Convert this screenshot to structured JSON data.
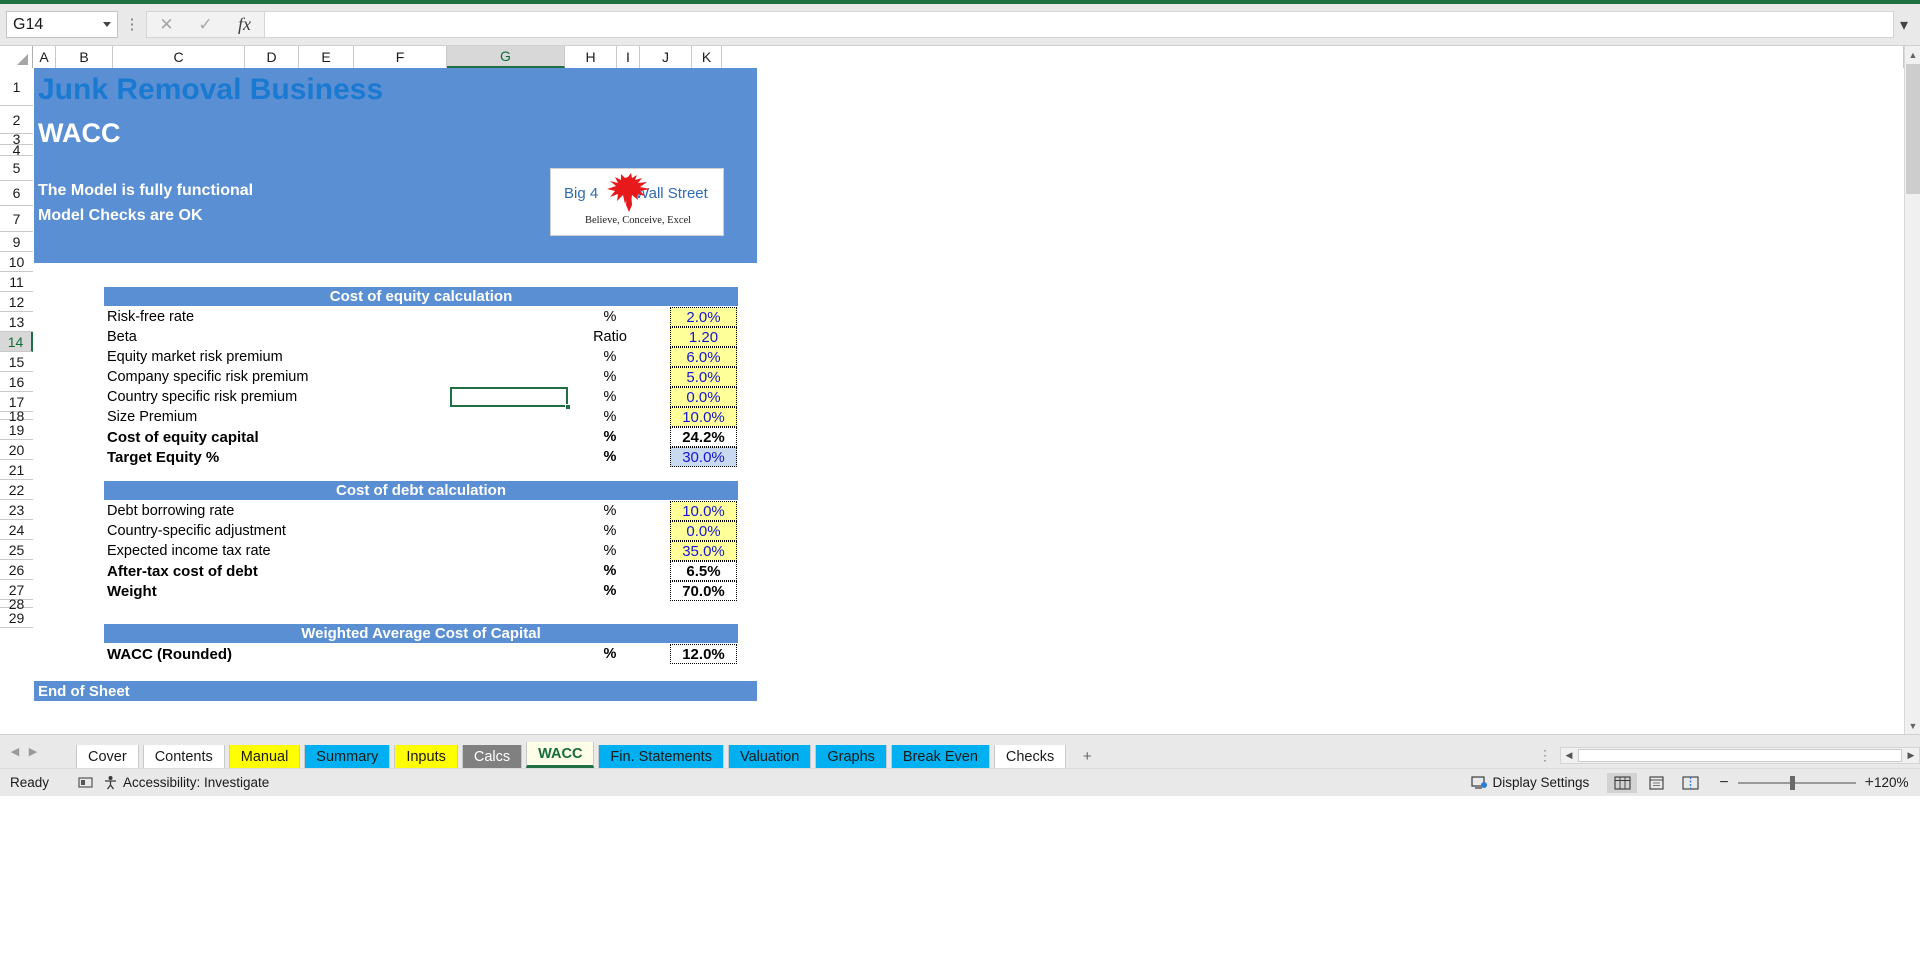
{
  "formula_bar": {
    "name_box_value": "G14",
    "formula_value": "",
    "cancel_icon": "cancel-icon",
    "confirm_icon": "confirm-icon",
    "function_icon": "fx-icon"
  },
  "grid": {
    "columns": [
      "A",
      "B",
      "C",
      "D",
      "E",
      "F",
      "G",
      "H",
      "I",
      "J",
      "K"
    ],
    "active_column": "G",
    "rows": [
      "1",
      "2",
      "3",
      "4",
      "5",
      "6",
      "7",
      "9",
      "10",
      "11",
      "12",
      "13",
      "14",
      "15",
      "16",
      "17",
      "18",
      "19",
      "20",
      "21",
      "22",
      "23",
      "24",
      "25",
      "26",
      "27",
      "28",
      "29"
    ],
    "active_row": "14"
  },
  "banner": {
    "title": "Junk Removal Business",
    "subtitle": "WACC",
    "note_1": "The Model is fully functional",
    "note_2": "Model Checks are OK"
  },
  "logo": {
    "text_left": "Big 4",
    "text_right": "Wall Street",
    "tagline": "Believe, Conceive, Excel",
    "eagle_icon": "eagle-icon"
  },
  "sections": [
    {
      "header": "Cost of equity calculation",
      "rows": [
        {
          "label": "Risk-free rate",
          "unit": "%",
          "value": "2.0%",
          "style": "input",
          "bold": false
        },
        {
          "label": "Beta",
          "unit": "Ratio",
          "value": "1.20",
          "style": "input",
          "bold": false
        },
        {
          "label": "Equity market risk premium",
          "unit": "%",
          "value": "6.0%",
          "style": "input",
          "bold": false
        },
        {
          "label": "Company specific risk premium",
          "unit": "%",
          "value": "5.0%",
          "style": "input",
          "bold": false
        },
        {
          "label": "Country specific risk premium",
          "unit": "%",
          "value": "0.0%",
          "style": "input",
          "bold": false
        },
        {
          "label": "Size Premium",
          "unit": "%",
          "value": "10.0%",
          "style": "input",
          "bold": false
        },
        {
          "label": "Cost of equity capital",
          "unit": "%",
          "value": "24.2%",
          "style": "calc",
          "bold": true
        },
        {
          "label": "Target Equity %",
          "unit": "%",
          "value": "30.0%",
          "style": "target",
          "bold": true
        }
      ]
    },
    {
      "header": "Cost of debt calculation",
      "rows": [
        {
          "label": "Debt borrowing rate",
          "unit": "%",
          "value": "10.0%",
          "style": "input",
          "bold": false
        },
        {
          "label": "Country-specific adjustment",
          "unit": "%",
          "value": "0.0%",
          "style": "input",
          "bold": false
        },
        {
          "label": "Expected income tax rate",
          "unit": "%",
          "value": "35.0%",
          "style": "input",
          "bold": false
        },
        {
          "label": "After-tax cost of debt",
          "unit": "%",
          "value": "6.5%",
          "style": "calc",
          "bold": true
        },
        {
          "label": "Weight",
          "unit": "%",
          "value": "70.0%",
          "style": "calc",
          "bold": true
        }
      ]
    },
    {
      "header": "Weighted Average Cost of Capital",
      "rows": [
        {
          "label": "WACC (Rounded)",
          "unit": "%",
          "value": "12.0%",
          "style": "calc",
          "bold": true
        }
      ]
    }
  ],
  "end_of_sheet": "End of Sheet",
  "tabs": [
    {
      "label": "Cover",
      "color": "#ffffff",
      "active": false
    },
    {
      "label": "Contents",
      "color": "#ffffff",
      "active": false
    },
    {
      "label": "Manual",
      "color": "#ffff00",
      "active": false
    },
    {
      "label": "Summary",
      "color": "#00b0f0",
      "active": false
    },
    {
      "label": "Inputs",
      "color": "#ffff00",
      "active": false
    },
    {
      "label": "Calcs",
      "color": "#808080",
      "active": false
    },
    {
      "label": "WACC",
      "color": "#fdfde8",
      "active": true
    },
    {
      "label": "Fin. Statements",
      "color": "#00b0f0",
      "active": false
    },
    {
      "label": "Valuation",
      "color": "#00b0f0",
      "active": false
    },
    {
      "label": "Graphs",
      "color": "#00b0f0",
      "active": false
    },
    {
      "label": "Break Even",
      "color": "#00b0f0",
      "active": false
    },
    {
      "label": "Checks",
      "color": "#ffffff",
      "active": false
    }
  ],
  "tab_add_label": "+",
  "status_bar": {
    "ready": "Ready",
    "accessibility": "Accessibility: Investigate",
    "display_settings": "Display Settings",
    "zoom": "120%",
    "normal_view_icon": "normal-view-icon",
    "page-layout_icon": "page-layout-icon",
    "page-break_icon": "page-break-icon",
    "zoom_out": "−",
    "zoom_in": "+"
  }
}
